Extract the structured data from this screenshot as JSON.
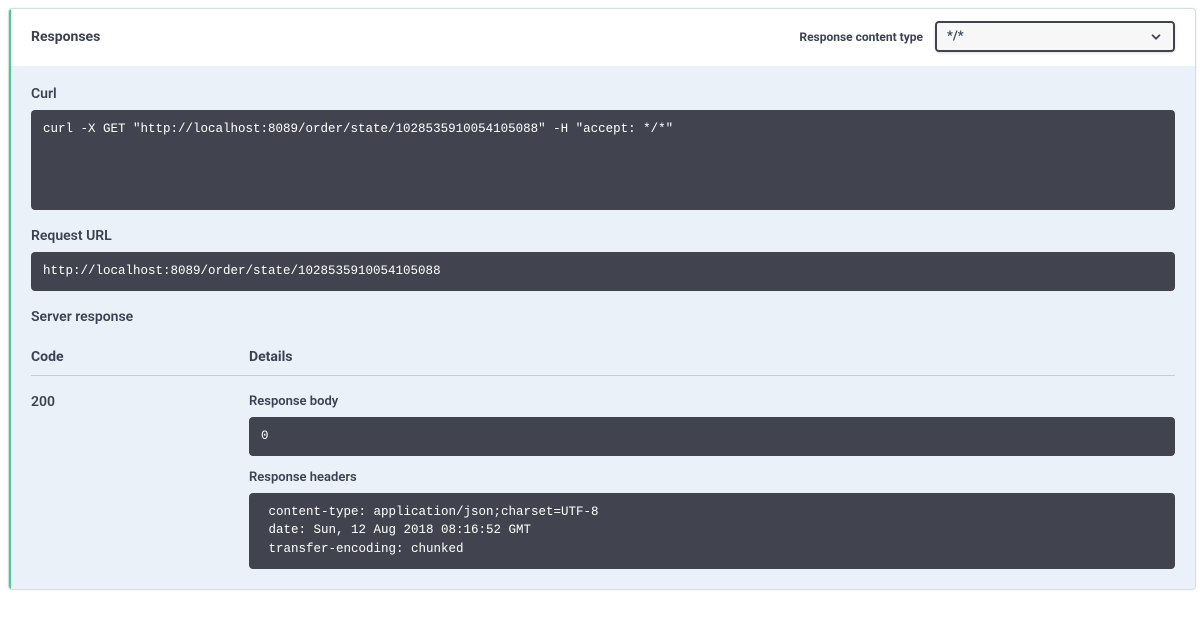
{
  "header": {
    "title": "Responses",
    "contentTypeLabel": "Response content type",
    "contentTypeValue": "*/*"
  },
  "curl": {
    "label": "Curl",
    "command": "curl -X GET \"http://localhost:8089/order/state/1028535910054105088\" -H \"accept: */*\""
  },
  "requestUrl": {
    "label": "Request URL",
    "value": "http://localhost:8089/order/state/1028535910054105088"
  },
  "serverResponse": {
    "label": "Server response",
    "columns": {
      "code": "Code",
      "details": "Details"
    },
    "row": {
      "code": "200",
      "responseBodyLabel": "Response body",
      "responseBody": "0",
      "responseHeadersLabel": "Response headers",
      "responseHeaders": " content-type: application/json;charset=UTF-8 \n date: Sun, 12 Aug 2018 08:16:52 GMT \n transfer-encoding: chunked "
    }
  }
}
